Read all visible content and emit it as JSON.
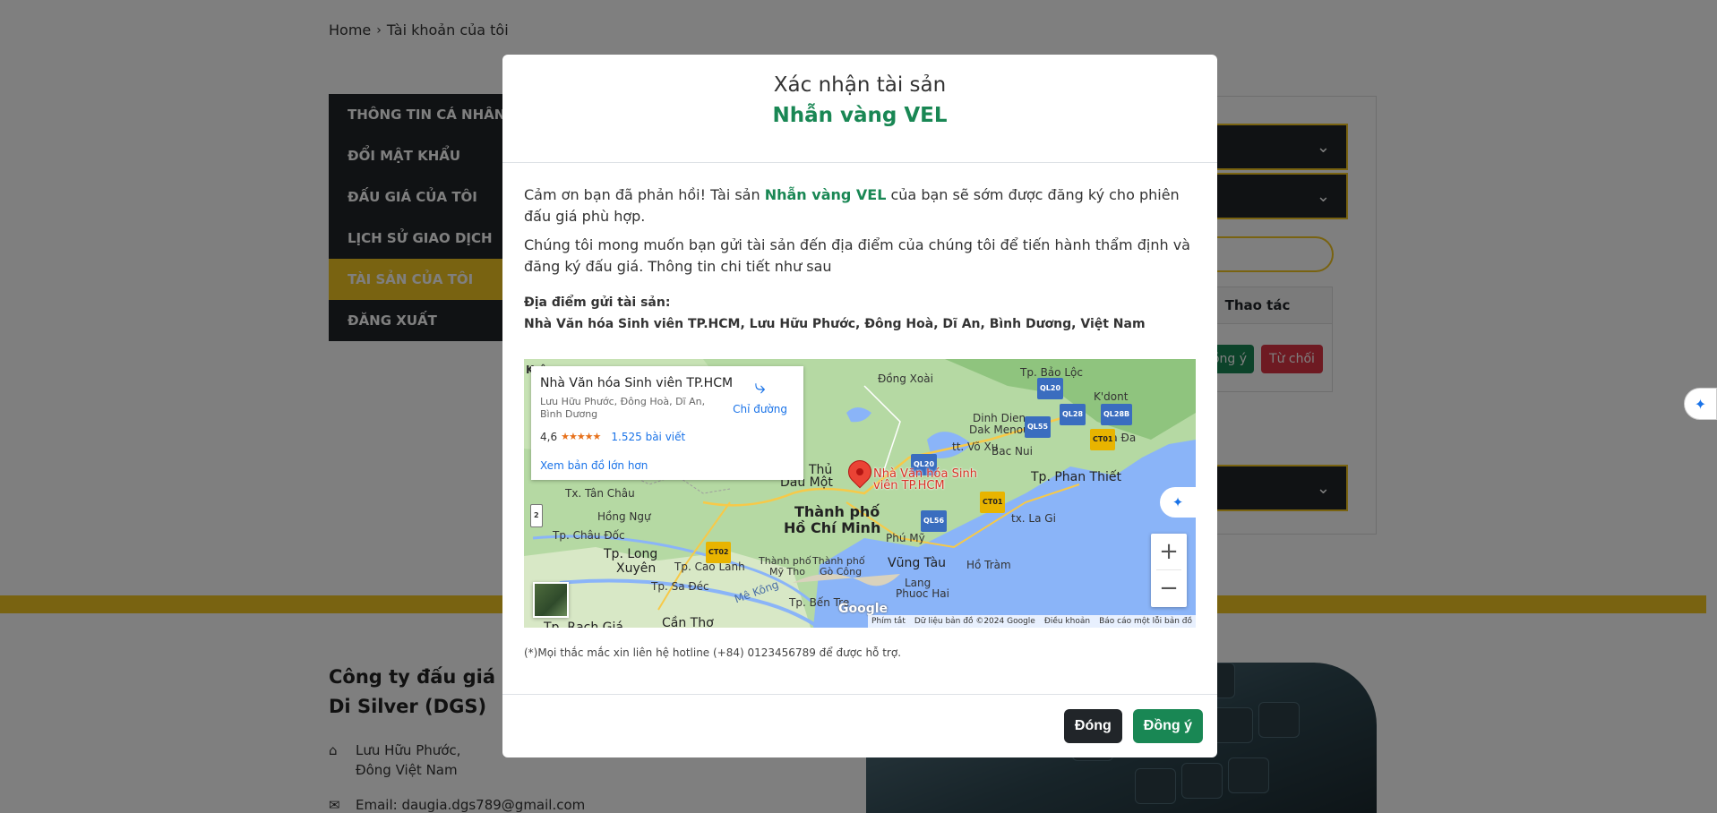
{
  "breadcrumb": {
    "home": "Home",
    "separator": "›",
    "current": "Tài khoản của tôi"
  },
  "sidebar": {
    "items": [
      {
        "label": "THÔNG TIN CÁ NHÂN"
      },
      {
        "label": "ĐỔI MẬT KHẨU"
      },
      {
        "label": "ĐẤU GIÁ CỦA TÔI"
      },
      {
        "label": "LỊCH SỬ GIAO DỊCH"
      },
      {
        "label": "TÀI SẢN CỦA TÔI",
        "active": true
      },
      {
        "label": "ĐĂNG XUẤT"
      }
    ]
  },
  "content": {
    "accordion_icon": "chevron-down-icon",
    "table_header": "Thao tác",
    "accept_label": "ồng ý",
    "reject_label": "Từ chối"
  },
  "footer": {
    "company": "Công ty đấu giá Di Silver (DGS)",
    "address": "Lưu Hữu Phước, Đông Việt Nam",
    "email": "Email: daugia.dgs789@gmail.com"
  },
  "modal": {
    "title": "Xác nhận tài sản",
    "asset_name": "Nhẫn vàng VEL",
    "para1_before": "Cảm ơn bạn đã phản hồi! Tài sản ",
    "para1_asset": "Nhẫn vàng VEL",
    "para1_after": " của bạn sẽ sớm được đăng ký cho phiên đấu giá phù hợp.",
    "para2": "Chúng tôi mong muốn bạn gửi tài sản đến địa điểm của chúng tôi để tiến hành thẩm định và đăng ký đấu giá. Thông tin chi tiết như sau",
    "location_label": "Địa điểm gửi tài sản:",
    "location_value": "Nhà Văn hóa Sinh viên TP.HCM, Lưu Hữu Phước, Đông Hoà, Dĩ An, Bình Dương, Việt Nam",
    "note": "(*)Mọi thắc mắc xin liên hệ hotline (+84) 0123456789 để được hỗ trợ.",
    "close_label": "Đóng",
    "confirm_label": "Đồng ý"
  },
  "map": {
    "place_name": "Nhà Văn hóa Sinh viên TP.HCM",
    "place_address": "Lưu Hữu Phước, Đông Hoà, Dĩ An, Bình Dương",
    "rating": "4,6",
    "stars": "★★★★★",
    "reviews": "1.525 bài viết",
    "directions": "Chỉ đường",
    "view_larger": "Xem bản đồ lớn hơn",
    "pin_label_line1": "Nhà Văn hóa Sinh",
    "pin_label_line2": "viên TP.HCM",
    "zoom_in": "+",
    "zoom_out": "−",
    "google": "Google",
    "attribution": [
      "Phím tắt",
      "Dữ liệu bản đồ ©2024 Google",
      "Điều khoản",
      "Báo cáo một lỗi bản đồ"
    ],
    "places": {
      "krong": "Krông",
      "dong_xoai": "Đồng Xoài",
      "bao_loc": "Tp. Bảo Lộc",
      "k_dont": "K'dont",
      "dinh_dien": "Dinh Dien",
      "dak_menou": "Dak Menou",
      "vo_xu": "tt. Võ Xu",
      "bac_nui": "Bac Nui",
      "hoa_da": "Hòa Đa",
      "thu_dau_mot_1": "Thủ",
      "thu_dau_mot_2": "Dầu Một",
      "phan_thiet": "Tp. Phan Thiết",
      "tan_chau": "Tx. Tân Châu",
      "hong_ngu": "Hồng Ngự",
      "hcm_1": "Thành phố",
      "hcm_2": "Hồ Chí Minh",
      "phu_my": "Phú Mỹ",
      "la_gi": "tx. La Gi",
      "chau_doc": "Tp. Châu Đốc",
      "long_xuyen_1": "Tp. Long",
      "long_xuyen_2": "Xuyên",
      "cao_lanh": "Tp. Cao Lãnh",
      "my_tho_1": "Thành phố",
      "my_tho_2": "Mỹ Tho",
      "go_cong_1": "Thành phố",
      "go_cong_2": "Gò Công",
      "vung_tau": "Vũng Tàu",
      "ho_tram": "Hồ Tràm",
      "lang_phuoc_1": "Lang",
      "lang_phuoc_2": "Phuoc Hai",
      "sa_dec": "Tp. Sa Đéc",
      "mekong": "Mê Kông",
      "ben_tre": "Tp. Bến Tre",
      "rach_gia": "Tp. Rạch Giá",
      "can_tho": "Cần Thơ"
    },
    "roads": [
      "QL20",
      "QL28",
      "QL28B",
      "QL55",
      "CT01",
      "QL20",
      "QL56",
      "CT01",
      "CT02",
      "2"
    ]
  }
}
